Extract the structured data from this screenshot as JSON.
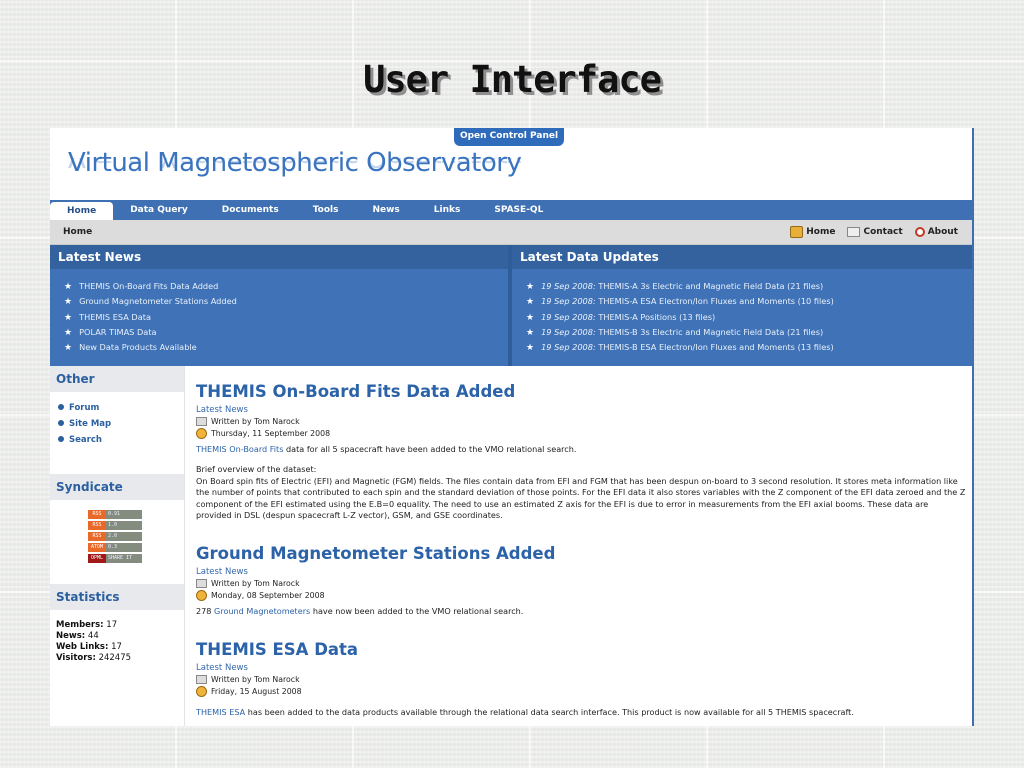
{
  "slide": {
    "title": "User Interface"
  },
  "site": {
    "open_control_panel": "Open Control Panel",
    "logo_text": "Virtual Magnetospheric Observatory"
  },
  "nav": {
    "items": [
      "Home",
      "Data Query",
      "Documents",
      "Tools",
      "News",
      "Links",
      "SPASE-QL"
    ],
    "active": "Home"
  },
  "breadcrumb": "Home",
  "top_links": [
    "Home",
    "Contact",
    "About"
  ],
  "latest_news": {
    "heading": "Latest News",
    "items": [
      "THEMIS On-Board Fits Data Added",
      "Ground Magnetometer Stations Added",
      "THEMIS ESA Data",
      "POLAR TIMAS Data",
      "New Data Products Available"
    ]
  },
  "latest_updates": {
    "heading": "Latest Data Updates",
    "items": [
      {
        "date": "19 Sep 2008:",
        "link": "THEMIS-A 3s Electric and Magnetic Field Data",
        "count": "(21 files)"
      },
      {
        "date": "19 Sep 2008:",
        "link": "THEMIS-A ESA Electron/Ion Fluxes and Moments",
        "count": "(10 files)"
      },
      {
        "date": "19 Sep 2008:",
        "link": "THEMIS-A Positions",
        "count": "(13 files)"
      },
      {
        "date": "19 Sep 2008:",
        "link": "THEMIS-B 3s Electric and Magnetic Field Data",
        "count": "(21 files)"
      },
      {
        "date": "19 Sep 2008:",
        "link": "THEMIS-B ESA Electron/Ion Fluxes and Moments",
        "count": "(13 files)"
      }
    ]
  },
  "sidebar": {
    "other_heading": "Other",
    "other_links": [
      "Forum",
      "Site Map",
      "Search"
    ],
    "syndicate_heading": "Syndicate",
    "syndicate_badges": [
      {
        "left": "RSS",
        "right": "0.91",
        "color": "#e8692a"
      },
      {
        "left": "RSS",
        "right": "1.0",
        "color": "#e8692a"
      },
      {
        "left": "RSS",
        "right": "2.0",
        "color": "#e8692a"
      },
      {
        "left": "ATOM",
        "right": "0.3",
        "color": "#e8692a"
      },
      {
        "left": "OPML",
        "right": "SHARE IT",
        "color": "#a01818"
      }
    ],
    "statistics_heading": "Statistics",
    "stats": [
      {
        "label": "Members:",
        "value": "17"
      },
      {
        "label": "News:",
        "value": "44"
      },
      {
        "label": "Web Links:",
        "value": "17"
      },
      {
        "label": "Visitors:",
        "value": "242475"
      }
    ]
  },
  "articles": [
    {
      "title": "THEMIS On-Board Fits Data Added",
      "category": "Latest News",
      "author": "Written by Tom Narock",
      "date": "Thursday, 11 September 2008",
      "lead_link": "THEMIS On-Board Fits",
      "lead_rest": " data for all 5 spacecraft have been added to the VMO relational search.",
      "body_title": "Brief overview of the dataset:",
      "body": "On Board spin fits of Electric (EFI) and Magnetic (FGM) fields. The files contain data from EFI and FGM that has been despun on-board to 3 second resolution. It stores meta information like the number of points that contributed to each spin and the standard deviation of those points. For the EFI data it also stores variables with the Z component of the EFI data zeroed and the Z component of the EFI estimated using the E.B=0 equality. The need to use an estimated Z axis for the EFI is due to error in measurements from the EFI axial booms. These data are provided in DSL (despun spacecraft L-Z vector), GSM, and GSE coordinates."
    },
    {
      "title": "Ground Magnetometer Stations Added",
      "category": "Latest News",
      "author": "Written by Tom Narock",
      "date": "Monday, 08 September 2008",
      "lead_pre": "278 ",
      "lead_link": "Ground Magnetometers",
      "lead_rest": " have now been added to the VMO relational search."
    },
    {
      "title": "THEMIS ESA Data",
      "category": "Latest News",
      "author": "Written by Tom Narock",
      "date": "Friday, 15 August 2008",
      "lead_link": "THEMIS ESA",
      "lead_rest": " has been added to the data products available through the relational data search interface. This product is now available for all 5 THEMIS spacecraft."
    }
  ]
}
